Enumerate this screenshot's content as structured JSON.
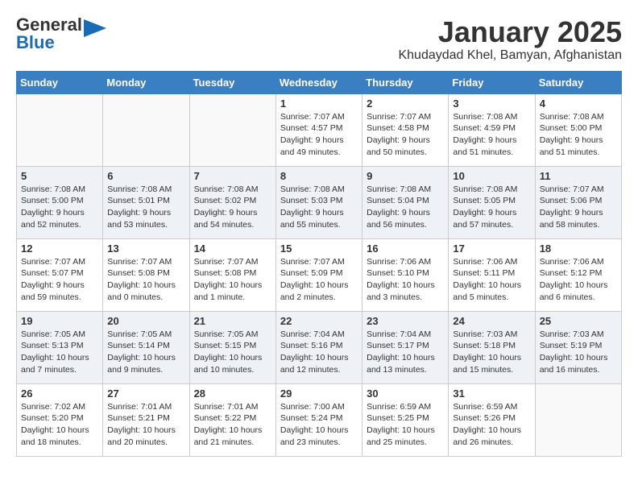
{
  "header": {
    "logo_general": "General",
    "logo_blue": "Blue",
    "title": "January 2025",
    "subtitle": "Khudaydad Khel, Bamyan, Afghanistan"
  },
  "weekdays": [
    "Sunday",
    "Monday",
    "Tuesday",
    "Wednesday",
    "Thursday",
    "Friday",
    "Saturday"
  ],
  "weeks": [
    [
      {
        "day": "",
        "info": ""
      },
      {
        "day": "",
        "info": ""
      },
      {
        "day": "",
        "info": ""
      },
      {
        "day": "1",
        "info": "Sunrise: 7:07 AM\nSunset: 4:57 PM\nDaylight: 9 hours\nand 49 minutes."
      },
      {
        "day": "2",
        "info": "Sunrise: 7:07 AM\nSunset: 4:58 PM\nDaylight: 9 hours\nand 50 minutes."
      },
      {
        "day": "3",
        "info": "Sunrise: 7:08 AM\nSunset: 4:59 PM\nDaylight: 9 hours\nand 51 minutes."
      },
      {
        "day": "4",
        "info": "Sunrise: 7:08 AM\nSunset: 5:00 PM\nDaylight: 9 hours\nand 51 minutes."
      }
    ],
    [
      {
        "day": "5",
        "info": "Sunrise: 7:08 AM\nSunset: 5:00 PM\nDaylight: 9 hours\nand 52 minutes."
      },
      {
        "day": "6",
        "info": "Sunrise: 7:08 AM\nSunset: 5:01 PM\nDaylight: 9 hours\nand 53 minutes."
      },
      {
        "day": "7",
        "info": "Sunrise: 7:08 AM\nSunset: 5:02 PM\nDaylight: 9 hours\nand 54 minutes."
      },
      {
        "day": "8",
        "info": "Sunrise: 7:08 AM\nSunset: 5:03 PM\nDaylight: 9 hours\nand 55 minutes."
      },
      {
        "day": "9",
        "info": "Sunrise: 7:08 AM\nSunset: 5:04 PM\nDaylight: 9 hours\nand 56 minutes."
      },
      {
        "day": "10",
        "info": "Sunrise: 7:08 AM\nSunset: 5:05 PM\nDaylight: 9 hours\nand 57 minutes."
      },
      {
        "day": "11",
        "info": "Sunrise: 7:07 AM\nSunset: 5:06 PM\nDaylight: 9 hours\nand 58 minutes."
      }
    ],
    [
      {
        "day": "12",
        "info": "Sunrise: 7:07 AM\nSunset: 5:07 PM\nDaylight: 9 hours\nand 59 minutes."
      },
      {
        "day": "13",
        "info": "Sunrise: 7:07 AM\nSunset: 5:08 PM\nDaylight: 10 hours\nand 0 minutes."
      },
      {
        "day": "14",
        "info": "Sunrise: 7:07 AM\nSunset: 5:08 PM\nDaylight: 10 hours\nand 1 minute."
      },
      {
        "day": "15",
        "info": "Sunrise: 7:07 AM\nSunset: 5:09 PM\nDaylight: 10 hours\nand 2 minutes."
      },
      {
        "day": "16",
        "info": "Sunrise: 7:06 AM\nSunset: 5:10 PM\nDaylight: 10 hours\nand 3 minutes."
      },
      {
        "day": "17",
        "info": "Sunrise: 7:06 AM\nSunset: 5:11 PM\nDaylight: 10 hours\nand 5 minutes."
      },
      {
        "day": "18",
        "info": "Sunrise: 7:06 AM\nSunset: 5:12 PM\nDaylight: 10 hours\nand 6 minutes."
      }
    ],
    [
      {
        "day": "19",
        "info": "Sunrise: 7:05 AM\nSunset: 5:13 PM\nDaylight: 10 hours\nand 7 minutes."
      },
      {
        "day": "20",
        "info": "Sunrise: 7:05 AM\nSunset: 5:14 PM\nDaylight: 10 hours\nand 9 minutes."
      },
      {
        "day": "21",
        "info": "Sunrise: 7:05 AM\nSunset: 5:15 PM\nDaylight: 10 hours\nand 10 minutes."
      },
      {
        "day": "22",
        "info": "Sunrise: 7:04 AM\nSunset: 5:16 PM\nDaylight: 10 hours\nand 12 minutes."
      },
      {
        "day": "23",
        "info": "Sunrise: 7:04 AM\nSunset: 5:17 PM\nDaylight: 10 hours\nand 13 minutes."
      },
      {
        "day": "24",
        "info": "Sunrise: 7:03 AM\nSunset: 5:18 PM\nDaylight: 10 hours\nand 15 minutes."
      },
      {
        "day": "25",
        "info": "Sunrise: 7:03 AM\nSunset: 5:19 PM\nDaylight: 10 hours\nand 16 minutes."
      }
    ],
    [
      {
        "day": "26",
        "info": "Sunrise: 7:02 AM\nSunset: 5:20 PM\nDaylight: 10 hours\nand 18 minutes."
      },
      {
        "day": "27",
        "info": "Sunrise: 7:01 AM\nSunset: 5:21 PM\nDaylight: 10 hours\nand 20 minutes."
      },
      {
        "day": "28",
        "info": "Sunrise: 7:01 AM\nSunset: 5:22 PM\nDaylight: 10 hours\nand 21 minutes."
      },
      {
        "day": "29",
        "info": "Sunrise: 7:00 AM\nSunset: 5:24 PM\nDaylight: 10 hours\nand 23 minutes."
      },
      {
        "day": "30",
        "info": "Sunrise: 6:59 AM\nSunset: 5:25 PM\nDaylight: 10 hours\nand 25 minutes."
      },
      {
        "day": "31",
        "info": "Sunrise: 6:59 AM\nSunset: 5:26 PM\nDaylight: 10 hours\nand 26 minutes."
      },
      {
        "day": "",
        "info": ""
      }
    ]
  ]
}
